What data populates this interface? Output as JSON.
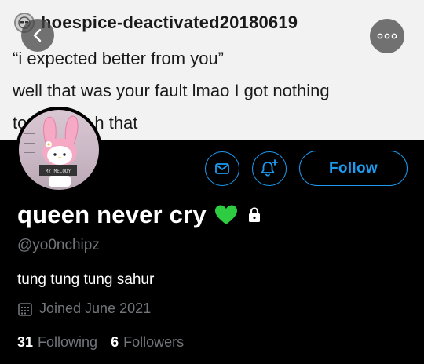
{
  "banner": {
    "username": "hoespice-deactivated20180619",
    "quote": "“i expected better from you”",
    "reply_line1": "well that was your fault lmao I got nothing",
    "reply_line2_start": "to",
    "reply_line2_end": "h that"
  },
  "avatar_text": "MY MELODY",
  "actions": {
    "follow_label": "Follow"
  },
  "profile": {
    "display_name": "queen never cry",
    "handle": "@yo0nchipz",
    "bio": "tung tung tung sahur",
    "joined": "Joined June 2021",
    "following_count": "31",
    "following_label": "Following",
    "followers_count": "6",
    "followers_label": "Followers"
  },
  "colors": {
    "accent": "#1d9bf0",
    "heart": "#2ecc40",
    "muted": "#71767b"
  },
  "icons": {
    "back": "arrow-left-icon",
    "more": "more-dots-icon",
    "message": "envelope-icon",
    "notify": "bell-plus-icon",
    "heart": "green-heart-icon",
    "lock": "lock-icon",
    "calendar": "calendar-icon"
  }
}
